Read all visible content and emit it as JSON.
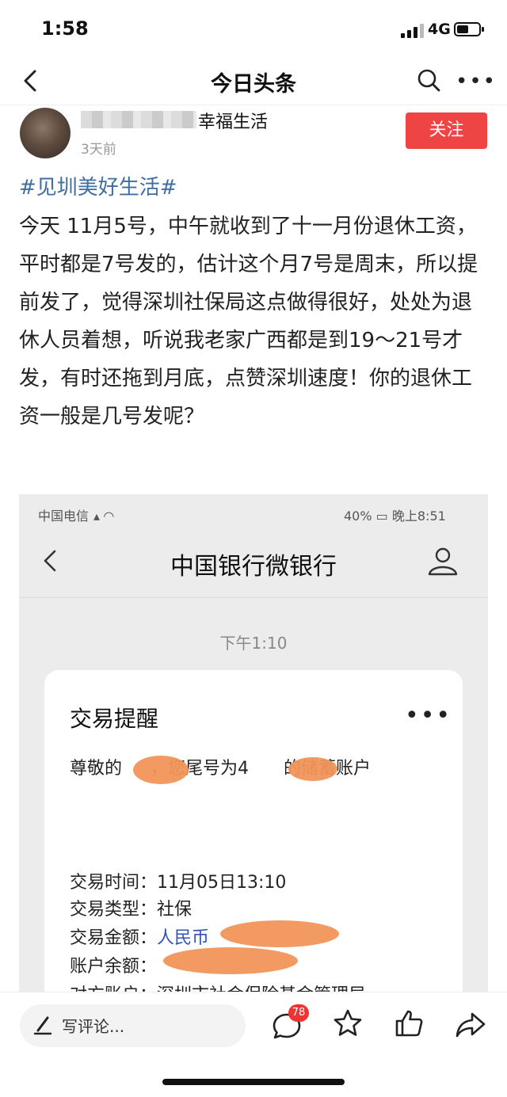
{
  "status_bar": {
    "time": "1:58",
    "network": "4G",
    "battery_level": 0.55
  },
  "nav": {
    "title": "今日头条"
  },
  "author": {
    "name": "幸福生活",
    "time_ago": "3天前",
    "follow_label": "关注"
  },
  "post": {
    "hashtag": "#见圳美好生活#",
    "body": "今天 11月5号，中午就收到了十一月份退休工资，平时都是7号发的，估计这个月7号是周末，所以提前发了，觉得深圳社保局这点做得很好，处处为退休人员着想，听说我老家广西都是到19～21号才发，有时还拖到月底，点赞深圳速度！你的退休工资一般是几号发呢？"
  },
  "screenshot": {
    "status_left": "中国电信",
    "status_right": "40%",
    "status_time": "晚上8:51",
    "title": "中国银行微银行",
    "msg_time": "下午1:10",
    "card": {
      "title": "交易提醒",
      "msg_1": "尊敬的",
      "msg_2": "，您尾号为4",
      "msg_3": "的储蓄账户",
      "rows": [
        {
          "label": "交易时间：",
          "value": "11月05日13:10"
        },
        {
          "label": "交易类型：",
          "value": "社保"
        },
        {
          "label": "交易金额：",
          "value": "人民币"
        },
        {
          "label": "账户余额：",
          "value": ""
        },
        {
          "label": "对方账户：",
          "value": "深圳市社会保险基金管理局"
        }
      ]
    }
  },
  "bottom": {
    "comment_placeholder": "写评论...",
    "comment_count": "78"
  }
}
